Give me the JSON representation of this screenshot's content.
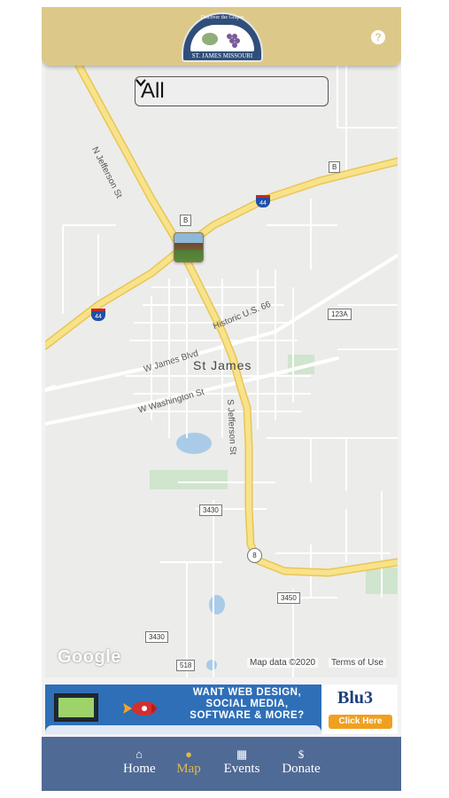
{
  "header": {
    "logo_tagline": "Discover the Grapes",
    "logo_name": "ST. JAMES MISSOURI",
    "help_icon": "question-circle-icon"
  },
  "map": {
    "filter": {
      "selected": "All"
    },
    "city": "St James",
    "streets": {
      "n_jefferson": "N Jefferson St",
      "s_jefferson": "S Jefferson St",
      "w_james": "W James Blvd",
      "historic_66": "Historic U.S. 66",
      "w_washington": "W Washington St"
    },
    "shields": {
      "b_top": "B",
      "b_mid": "B",
      "i44_top": "44",
      "i44_left": "44",
      "r123a": "123A",
      "r3430a": "3430",
      "r8": "8",
      "r3450": "3450",
      "r3430b": "3430",
      "r518": "518"
    },
    "google": "Google",
    "attribution": "Map data ©2020",
    "terms": "Terms of Use"
  },
  "banner": {
    "line1": "WANT WEB DESIGN,",
    "line2": "SOCIAL MEDIA,",
    "line3": "SOFTWARE & MORE?",
    "brand": "Blu3",
    "cta": "Click Here"
  },
  "nav": {
    "items": [
      {
        "label": "Home",
        "icon": "home-icon"
      },
      {
        "label": "Map",
        "icon": "globe-icon"
      },
      {
        "label": "Events",
        "icon": "calendar-icon"
      },
      {
        "label": "Donate",
        "icon": "dollar-icon"
      }
    ],
    "active": "Map",
    "active_color": "#e0b84a"
  },
  "colors": {
    "header": "#dcc98a",
    "nav": "#506a96",
    "highway": "#f5d66e"
  }
}
